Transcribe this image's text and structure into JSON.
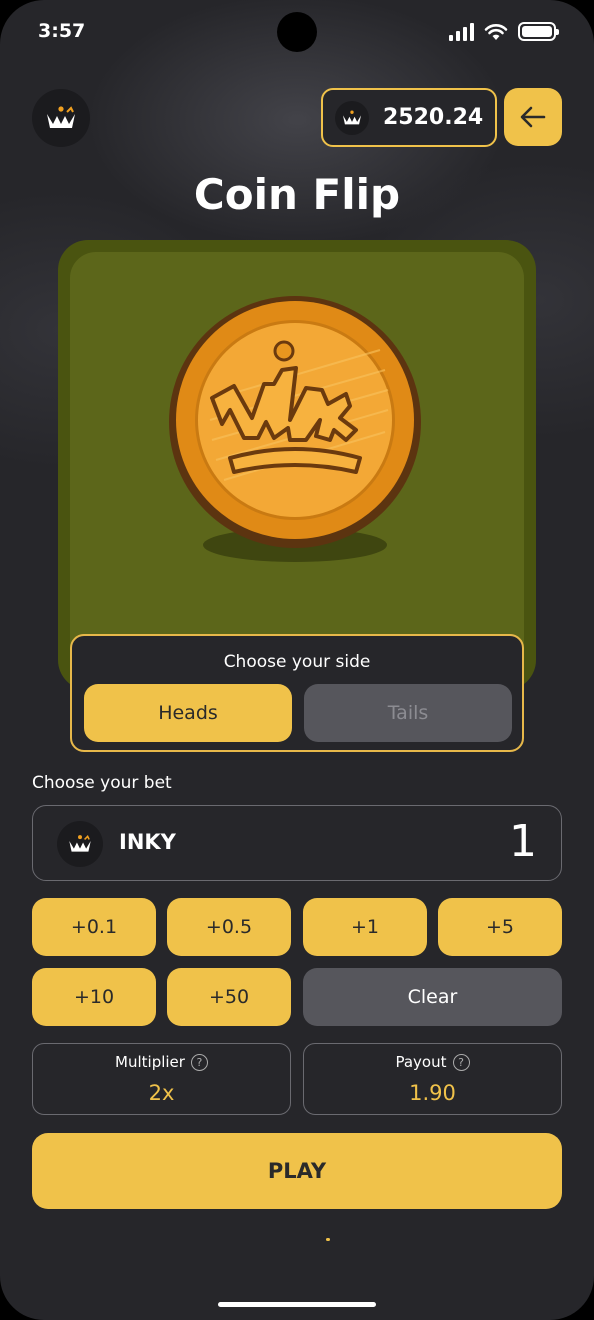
{
  "status_bar": {
    "time": "3:57"
  },
  "header": {
    "balance": "2520.24"
  },
  "title": "Coin Flip",
  "side_chooser": {
    "label": "Choose your side",
    "options": [
      "Heads",
      "Tails"
    ],
    "selected": "Heads"
  },
  "bet": {
    "label": "Choose your bet",
    "token": "INKY",
    "amount": "1",
    "quick_amounts": [
      "+0.1",
      "+0.5",
      "+1",
      "+5",
      "+10",
      "+50"
    ],
    "clear_label": "Clear"
  },
  "stats": {
    "multiplier_label": "Multiplier",
    "multiplier_value": "2x",
    "payout_label": "Payout",
    "payout_value": "1.90"
  },
  "play_label": "PLAY",
  "colors": {
    "accent": "#f0c24a",
    "background": "#26262a",
    "card": "#5c661a"
  },
  "icons": [
    "crown-logo-icon",
    "back-arrow-icon",
    "help-icon",
    "signal-icon",
    "wifi-icon",
    "battery-icon"
  ]
}
